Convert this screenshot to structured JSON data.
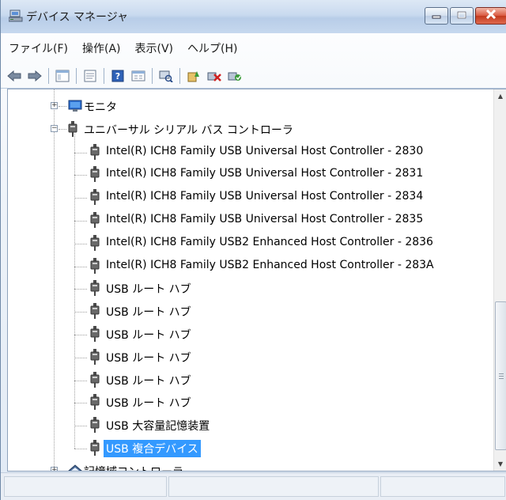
{
  "window": {
    "title": "デバイス マネージャ",
    "buttons": {
      "minimize": "minimize",
      "maximize": "maximize",
      "close": "close"
    }
  },
  "menu": [
    {
      "label": "ファイル(F)"
    },
    {
      "label": "操作(A)"
    },
    {
      "label": "表示(V)"
    },
    {
      "label": "ヘルプ(H)"
    }
  ],
  "toolbar": [
    "back-icon",
    "forward-icon",
    "|",
    "console-tree-icon",
    "|",
    "properties-icon",
    "|",
    "help-icon",
    "view-icon",
    "|",
    "scan-hardware-icon",
    "|",
    "update-driver-icon",
    "disable-device-icon",
    "uninstall-device-icon"
  ],
  "tree": {
    "items": [
      {
        "label": "モニタ",
        "level": 1,
        "icon": "monitor-icon",
        "expander": "+",
        "selected": false
      },
      {
        "label": "ユニバーサル シリアル バス コントローラ",
        "level": 1,
        "icon": "usb-icon",
        "expander": "-",
        "selected": false
      },
      {
        "label": "Intel(R) ICH8 Family USB Universal Host Controller - 2830",
        "level": 2,
        "icon": "usb-icon",
        "selected": false
      },
      {
        "label": "Intel(R) ICH8 Family USB Universal Host Controller - 2831",
        "level": 2,
        "icon": "usb-icon",
        "selected": false
      },
      {
        "label": "Intel(R) ICH8 Family USB Universal Host Controller - 2834",
        "level": 2,
        "icon": "usb-icon",
        "selected": false
      },
      {
        "label": "Intel(R) ICH8 Family USB Universal Host Controller - 2835",
        "level": 2,
        "icon": "usb-icon",
        "selected": false
      },
      {
        "label": "Intel(R) ICH8 Family USB2 Enhanced Host Controller - 2836",
        "level": 2,
        "icon": "usb-icon",
        "selected": false
      },
      {
        "label": "Intel(R) ICH8 Family USB2 Enhanced Host Controller - 283A",
        "level": 2,
        "icon": "usb-icon",
        "selected": false
      },
      {
        "label": "USB ルート ハブ",
        "level": 2,
        "icon": "usb-icon",
        "selected": false
      },
      {
        "label": "USB ルート ハブ",
        "level": 2,
        "icon": "usb-icon",
        "selected": false
      },
      {
        "label": "USB ルート ハブ",
        "level": 2,
        "icon": "usb-icon",
        "selected": false
      },
      {
        "label": "USB ルート ハブ",
        "level": 2,
        "icon": "usb-icon",
        "selected": false
      },
      {
        "label": "USB ルート ハブ",
        "level": 2,
        "icon": "usb-icon",
        "selected": false
      },
      {
        "label": "USB ルート ハブ",
        "level": 2,
        "icon": "usb-icon",
        "selected": false
      },
      {
        "label": "USB 大容量記憶装置",
        "level": 2,
        "icon": "usb-icon",
        "selected": false
      },
      {
        "label": "USB 複合デバイス",
        "level": 2,
        "icon": "usb-icon",
        "selected": true
      },
      {
        "label": "記憶域コントローラ",
        "level": 1,
        "icon": "storage-controller-icon",
        "expander": "+",
        "selected": false
      }
    ]
  },
  "colors": {
    "selection": "#3399ff",
    "selection_text": "#ffffff",
    "close_button": "#c7432a"
  }
}
